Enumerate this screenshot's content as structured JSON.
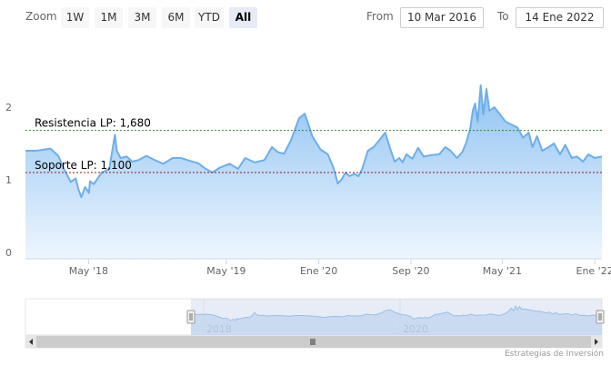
{
  "toolbar": {
    "zoom_label": "Zoom",
    "buttons": [
      "1W",
      "1M",
      "3M",
      "6M",
      "YTD",
      "All"
    ],
    "active_button": "All",
    "from_label": "From",
    "from_value": "10 Mar 2016",
    "to_label": "To",
    "to_value": "14 Ene 2022"
  },
  "credit": "Estrategias de Inversión",
  "colors": {
    "line": "#6eaee8",
    "area_top": "#8fc3f3",
    "area_bottom": "#eef6fe",
    "resistance": "#2e8b3a",
    "support": "#8b1a2a",
    "navigator_fill": "#c9d4ec"
  },
  "chart_data": {
    "type": "area",
    "title": "",
    "xlabel": "",
    "ylabel": "",
    "ylim": [
      0,
      2.5
    ],
    "yticks": [
      0,
      1,
      2
    ],
    "xlim": [
      "2017-11-15",
      "2022-01-20"
    ],
    "xticks": [
      {
        "date": "2018-05-01",
        "label": "May '18"
      },
      {
        "date": "2019-05-01",
        "label": "May '19"
      },
      {
        "date": "2020-01-01",
        "label": "Ene '20"
      },
      {
        "date": "2020-09-01",
        "label": "Sep '20"
      },
      {
        "date": "2021-05-01",
        "label": "May '21"
      },
      {
        "date": "2022-01-01",
        "label": "Ene '22"
      }
    ],
    "plot_lines": [
      {
        "label": "Resistencia LP: 1,680",
        "value": 1.68,
        "color": "#2e8b3a"
      },
      {
        "label": "Soporte LP: 1,100",
        "value": 1.1,
        "color": "#8b1a2a"
      }
    ],
    "navigator": {
      "xlim": [
        "2016-03-10",
        "2022-01-20"
      ],
      "labels": [
        {
          "date": "2018-01-01",
          "label": "2018"
        },
        {
          "date": "2020-01-01",
          "label": "2020"
        }
      ]
    },
    "series": [
      {
        "x": [
          "2017-11-15",
          "2017-12-15",
          "2018-01-20",
          "2018-02-10",
          "2018-02-25",
          "2018-03-15",
          "2018-03-28",
          "2018-04-05",
          "2018-04-12",
          "2018-04-22",
          "2018-05-02",
          "2018-05-05",
          "2018-05-15",
          "2018-06-05",
          "2018-06-25",
          "2018-07-10",
          "2018-07-15",
          "2018-07-25",
          "2018-08-10",
          "2018-08-25",
          "2018-09-10",
          "2018-10-01",
          "2018-10-20",
          "2018-11-15",
          "2018-12-10",
          "2019-01-01",
          "2019-01-25",
          "2019-02-15",
          "2019-03-05",
          "2019-03-25",
          "2019-04-15",
          "2019-05-10",
          "2019-06-01",
          "2019-06-20",
          "2019-07-15",
          "2019-08-10",
          "2019-08-30",
          "2019-09-15",
          "2019-10-01",
          "2019-10-20",
          "2019-11-10",
          "2019-11-25",
          "2019-12-15",
          "2020-01-05",
          "2020-01-25",
          "2020-02-10",
          "2020-02-20",
          "2020-03-01",
          "2020-03-12",
          "2020-03-22",
          "2020-04-05",
          "2020-04-15",
          "2020-04-25",
          "2020-05-10",
          "2020-05-25",
          "2020-06-10",
          "2020-06-25",
          "2020-07-10",
          "2020-07-20",
          "2020-08-01",
          "2020-08-10",
          "2020-08-20",
          "2020-09-05",
          "2020-09-20",
          "2020-10-05",
          "2020-10-25",
          "2020-11-15",
          "2020-12-01",
          "2020-12-15",
          "2021-01-01",
          "2021-01-15",
          "2021-01-25",
          "2021-02-05",
          "2021-02-12",
          "2021-02-18",
          "2021-02-25",
          "2021-03-05",
          "2021-03-12",
          "2021-03-20",
          "2021-03-28",
          "2021-04-10",
          "2021-04-25",
          "2021-05-10",
          "2021-05-25",
          "2021-06-10",
          "2021-06-25",
          "2021-07-10",
          "2021-07-20",
          "2021-08-01",
          "2021-08-15",
          "2021-09-01",
          "2021-09-15",
          "2021-10-01",
          "2021-10-15",
          "2021-11-01",
          "2021-11-15",
          "2021-12-01",
          "2021-12-15",
          "2022-01-01",
          "2022-01-20"
        ],
        "y": [
          1.4,
          1.4,
          1.43,
          1.33,
          1.15,
          0.97,
          1.02,
          0.86,
          0.76,
          0.9,
          0.82,
          0.98,
          0.94,
          1.1,
          1.15,
          1.62,
          1.4,
          1.3,
          1.32,
          1.25,
          1.27,
          1.33,
          1.28,
          1.22,
          1.3,
          1.3,
          1.26,
          1.23,
          1.16,
          1.1,
          1.17,
          1.22,
          1.15,
          1.3,
          1.24,
          1.27,
          1.45,
          1.38,
          1.36,
          1.55,
          1.85,
          1.91,
          1.6,
          1.42,
          1.35,
          1.15,
          0.95,
          1.0,
          1.1,
          1.05,
          1.08,
          1.05,
          1.15,
          1.4,
          1.45,
          1.55,
          1.65,
          1.4,
          1.25,
          1.3,
          1.24,
          1.35,
          1.29,
          1.44,
          1.32,
          1.34,
          1.35,
          1.45,
          1.4,
          1.3,
          1.38,
          1.5,
          1.7,
          1.95,
          2.05,
          1.8,
          2.3,
          1.9,
          2.25,
          1.95,
          2.0,
          1.9,
          1.8,
          1.76,
          1.72,
          1.58,
          1.65,
          1.45,
          1.6,
          1.4,
          1.45,
          1.5,
          1.35,
          1.48,
          1.3,
          1.32,
          1.25,
          1.35,
          1.3,
          1.32
        ]
      }
    ]
  }
}
